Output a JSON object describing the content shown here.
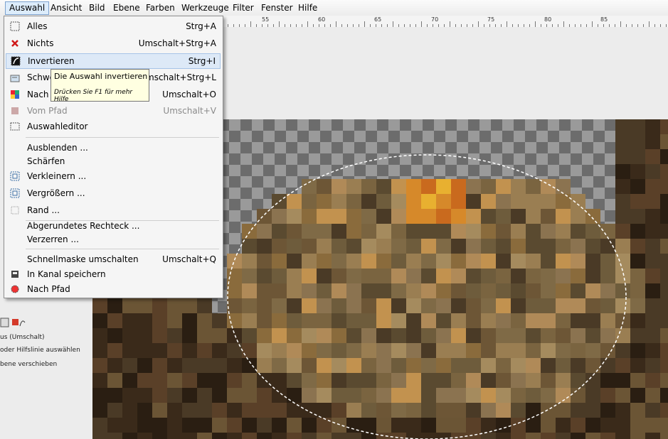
{
  "menubar": [
    "Auswahl",
    "Ansicht",
    "Bild",
    "Ebene",
    "Farben",
    "Werkzeuge",
    "Filter",
    "Fenster",
    "Hilfe"
  ],
  "ruler_labels": [
    "55",
    "60",
    "65",
    "70",
    "75",
    "80",
    "85"
  ],
  "menu": [
    {
      "label": "Alles",
      "shortcut": "Strg+A",
      "icon": "select-all-icon"
    },
    {
      "label": "Nichts",
      "shortcut": "Umschalt+Strg+A",
      "icon": "select-none-icon"
    },
    {
      "label": "Invertieren",
      "shortcut": "Strg+I",
      "icon": "invert-icon",
      "highlighted": true
    },
    {
      "label": "Schwebend",
      "shortcut": "Umschalt+Strg+L",
      "icon": "float-icon"
    },
    {
      "label": "Nach Farbe",
      "shortcut": "Umschalt+O",
      "icon": "by-color-icon"
    },
    {
      "label": "Vom Pfad",
      "shortcut": "Umschalt+V",
      "icon": "from-path-icon",
      "disabled": true
    },
    {
      "label": "Auswahleditor",
      "shortcut": "",
      "icon": "selection-editor-icon"
    },
    {
      "label": "Ausblenden ...",
      "shortcut": ""
    },
    {
      "label": "Schärfen",
      "shortcut": ""
    },
    {
      "label": "Verkleinern ...",
      "shortcut": "",
      "icon": "shrink-icon"
    },
    {
      "label": "Vergrößern ...",
      "shortcut": "",
      "icon": "grow-icon"
    },
    {
      "label": "Rand ...",
      "shortcut": "",
      "icon": "border-icon"
    },
    {
      "label": "Abgerundetes Rechteck ...",
      "shortcut": ""
    },
    {
      "label": "Verzerren ...",
      "shortcut": ""
    },
    {
      "label": "Schnellmaske umschalten",
      "shortcut": "Umschalt+Q"
    },
    {
      "label": "In Kanal speichern",
      "shortcut": "",
      "icon": "save-channel-icon"
    },
    {
      "label": "Nach Pfad",
      "shortcut": "",
      "icon": "to-path-icon"
    }
  ],
  "tooltip": {
    "title": "Die Auswahl invertieren",
    "help": "Drücken Sie F1 für mehr Hilfe"
  },
  "tool_options": [
    "us (Umschalt)",
    "oder Hilfslinie auswählen",
    "bene verschieben"
  ]
}
